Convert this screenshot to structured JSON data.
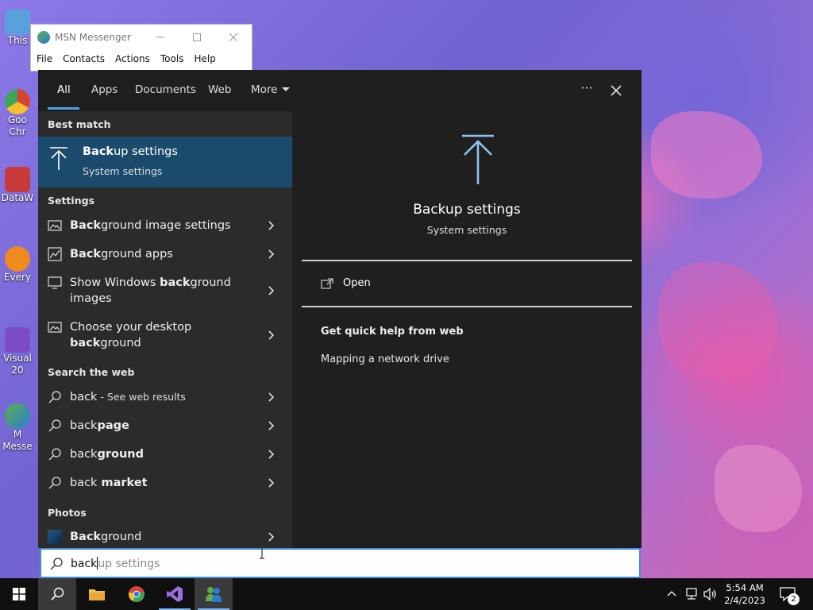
{
  "desktop": {
    "icons": [
      {
        "label": "This"
      },
      {
        "label": "Goo Chr"
      },
      {
        "label": "DataW"
      },
      {
        "label": "Every"
      },
      {
        "label": "Visual 20"
      },
      {
        "label": "M Messe"
      }
    ]
  },
  "msn_window": {
    "title": "MSN Messenger",
    "menu": [
      "File",
      "Contacts",
      "Actions",
      "Tools",
      "Help"
    ]
  },
  "search_panel": {
    "tabs": [
      "All",
      "Apps",
      "Documents",
      "Web",
      "More"
    ],
    "options_label": "···",
    "sections": {
      "best_match": "Best match",
      "settings": "Settings",
      "search_web": "Search the web",
      "photos": "Photos"
    },
    "best_match": {
      "title_bold": "Back",
      "title_rest": "up settings",
      "subtitle": "System settings"
    },
    "settings_results": [
      {
        "bold": "Back",
        "rest": "ground image settings"
      },
      {
        "bold": "Back",
        "rest": "ground apps"
      },
      {
        "pre": "Show Windows ",
        "bold": "back",
        "rest": "ground images"
      },
      {
        "pre": "Choose your desktop ",
        "bold": "back",
        "rest": "ground"
      }
    ],
    "web_results": [
      {
        "pre": "back",
        "suffix": " - See web results"
      },
      {
        "pre": "back",
        "bold": "page"
      },
      {
        "pre": "back",
        "bold": "ground"
      },
      {
        "pre": "back",
        "bold": " market"
      }
    ],
    "photo_results": [
      {
        "bold": "Back",
        "rest": "ground"
      }
    ],
    "preview": {
      "title": "Backup settings",
      "subtitle": "System settings",
      "open_label": "Open",
      "quick_help_title": "Get quick help from web",
      "help_links": [
        "Mapping a network drive"
      ]
    }
  },
  "search_box": {
    "typed": "back",
    "suggestion": "up settings"
  },
  "taskbar": {
    "time": "5:54 AM",
    "date": "2/4/2023",
    "notifications": "2"
  },
  "colors": {
    "accent": "#4ba0e6",
    "best_match_bg": "#1b4b6c",
    "panel_bg": "#1f1f1f",
    "results_bg": "#2b2b2b"
  }
}
